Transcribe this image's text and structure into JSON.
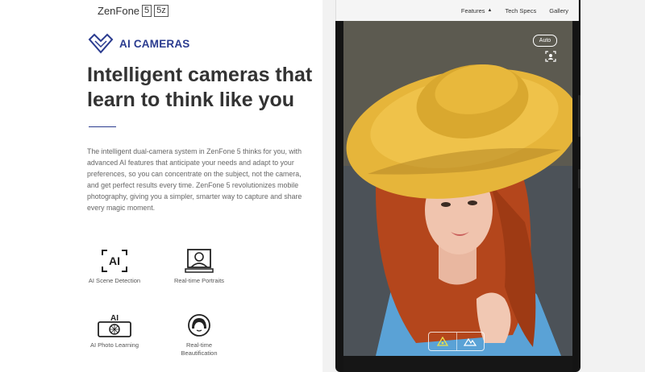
{
  "brand": {
    "name": "ZenFone",
    "model_a": "5",
    "model_b": "5z"
  },
  "section": {
    "title": "AI CAMERAS",
    "icon": "heart-diamond-icon"
  },
  "headline": "Intelligent cameras that learn to think like you",
  "description": "The intelligent dual-camera system in ZenFone 5 thinks for you, with advanced AI features that anticipate your needs and adapt to your preferences, so you can concentrate on the subject, not the camera, and get perfect results every time. ZenFone 5 revolutionizes mobile photography, giving you a simpler, smarter way to capture and share every magic moment.",
  "features": [
    {
      "label": "AI Scene Detection",
      "icon": "ai-scene-icon"
    },
    {
      "label": "Real-time Portraits",
      "icon": "portrait-frame-icon"
    },
    {
      "label": "AI Photo Learning",
      "icon": "ai-photo-learning-icon"
    },
    {
      "label": "Real-time Beautification",
      "icon": "beautification-face-icon"
    }
  ],
  "nav": {
    "items": [
      "Features",
      "Tech Specs",
      "Gallery"
    ]
  },
  "camera": {
    "mode_badge": "Auto"
  },
  "colors": {
    "accent": "#2a3b8f",
    "hat": "#e6b53a",
    "hair": "#b4461c",
    "shirt": "#5aa2d6"
  }
}
